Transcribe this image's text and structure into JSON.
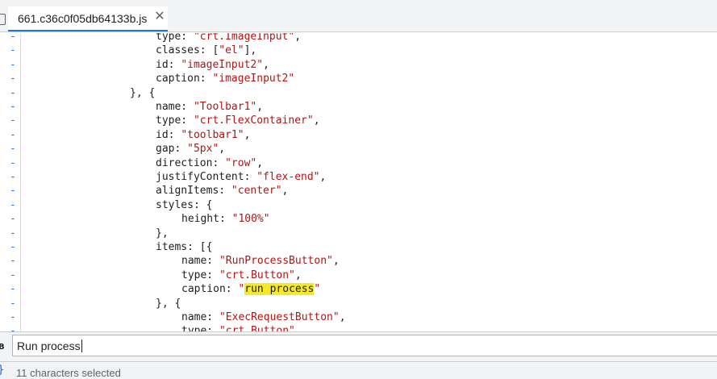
{
  "tab": {
    "filename": "661.c36c0f05db64133b.js",
    "close_glyph": "✕"
  },
  "editor": {
    "marker": "-",
    "lines": [
      [
        {
          "t": "type: "
        },
        {
          "s": "\"crt.ImageInput\""
        },
        {
          "t": ","
        }
      ],
      [
        {
          "t": "classes: ["
        },
        {
          "s": "\"el\""
        },
        {
          "t": "],"
        }
      ],
      [
        {
          "t": "id: "
        },
        {
          "s": "\"imageInput2\""
        },
        {
          "t": ","
        }
      ],
      [
        {
          "t": "caption: "
        },
        {
          "s": "\"imageInput2\""
        }
      ],
      [
        {
          "t": "}, {"
        }
      ],
      [
        {
          "t": "name: "
        },
        {
          "s": "\"Toolbar1\""
        },
        {
          "t": ","
        }
      ],
      [
        {
          "t": "type: "
        },
        {
          "s": "\"crt.FlexContainer\""
        },
        {
          "t": ","
        }
      ],
      [
        {
          "t": "id: "
        },
        {
          "s": "\"toolbar1\""
        },
        {
          "t": ","
        }
      ],
      [
        {
          "t": "gap: "
        },
        {
          "s": "\"5px\""
        },
        {
          "t": ","
        }
      ],
      [
        {
          "t": "direction: "
        },
        {
          "s": "\"row\""
        },
        {
          "t": ","
        }
      ],
      [
        {
          "t": "justifyContent: "
        },
        {
          "s": "\"flex-end\""
        },
        {
          "t": ","
        }
      ],
      [
        {
          "t": "alignItems: "
        },
        {
          "s": "\"center\""
        },
        {
          "t": ","
        }
      ],
      [
        {
          "t": "styles: {"
        }
      ],
      [
        {
          "t": "height: "
        },
        {
          "s": "\"100%\""
        }
      ],
      [
        {
          "t": "},"
        }
      ],
      [
        {
          "t": "items: [{"
        }
      ],
      [
        {
          "t": "name: "
        },
        {
          "s": "\"RunProcessButton\""
        },
        {
          "t": ","
        }
      ],
      [
        {
          "t": "type: "
        },
        {
          "s": "\"crt.Button\""
        },
        {
          "t": ","
        }
      ],
      [
        {
          "t": "caption: "
        },
        {
          "s": "\""
        },
        {
          "h": "run process"
        },
        {
          "s": "\""
        }
      ],
      [
        {
          "t": "}, {"
        }
      ],
      [
        {
          "t": "name: "
        },
        {
          "s": "\"ExecRequestButton\""
        },
        {
          "t": ","
        }
      ],
      [
        {
          "t": "type: "
        },
        {
          "s": "\"crt.Button\""
        }
      ]
    ]
  },
  "search": {
    "value": "Run process",
    "icon_glyph": "B"
  },
  "status": {
    "text": "11 characters selected",
    "icon_glyph": "}"
  }
}
